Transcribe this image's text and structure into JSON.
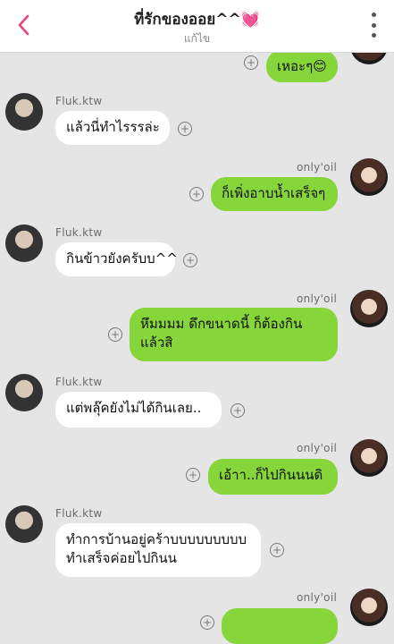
{
  "header": {
    "title": "ที่รักของออย^^",
    "heart": "💓",
    "subtitle": "แก้ไข"
  },
  "messages": [
    {
      "sender": "me",
      "text": "เหอะๆ😊"
    },
    {
      "sender": "them",
      "name": "Fluk.ktw",
      "text": "แล้วนี่ทำไรรรล่ะ"
    },
    {
      "sender": "me",
      "name": "only'oil",
      "text": "ก็เพิ่งอาบน้ำเสร็จๆ"
    },
    {
      "sender": "them",
      "name": "Fluk.ktw",
      "text": "กินข้าวยังครับบ^^"
    },
    {
      "sender": "me",
      "name": "only'oil",
      "line1": "หึมมมม ดึกขนาดนี้ ก็ต้องกิน",
      "line2": "แล้วสิ"
    },
    {
      "sender": "them",
      "name": "Fluk.ktw",
      "text": "แต่พลุ๊คยังไม่ได้กินเลย.."
    },
    {
      "sender": "me",
      "name": "only'oil",
      "text": "เอ้าา..ก็ไปกินนนดิ"
    },
    {
      "sender": "them",
      "name": "Fluk.ktw",
      "line1": "ทำการบ้านอยู่คร้าบบบบบบบบบ",
      "line2": "ทำเสร็จค่อยไปกินน"
    },
    {
      "sender": "me",
      "name": "only'oil",
      "text": "…"
    }
  ],
  "icons": {
    "back": "chevron-left-icon",
    "menu": "more-vertical-icon",
    "react": "add-reaction-icon"
  },
  "colors": {
    "accent": "#e8457a",
    "my_bubble": "#86d63b",
    "their_bubble": "#ffffff",
    "background": "#e5e5e5"
  }
}
